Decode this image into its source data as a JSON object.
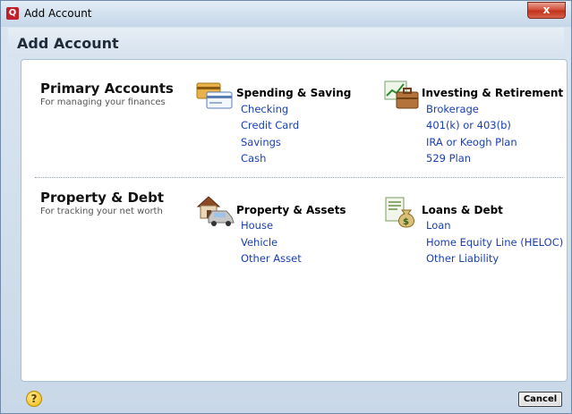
{
  "window": {
    "title": "Add Account",
    "close_label": "x"
  },
  "header": {
    "title": "Add Account"
  },
  "primary": {
    "title": "Primary Accounts",
    "subtitle": "For managing your finances",
    "spending": {
      "title": "Spending & Saving",
      "icon": "credit-card-icon",
      "links": [
        "Checking",
        "Credit Card",
        "Savings",
        "Cash"
      ]
    },
    "investing": {
      "title": "Investing & Retirement",
      "icon": "chart-briefcase-icon",
      "links": [
        "Brokerage",
        "401(k) or 403(b)",
        "IRA or Keogh Plan",
        "529 Plan"
      ]
    }
  },
  "property": {
    "title": "Property & Debt",
    "subtitle": "For tracking your net worth",
    "assets": {
      "title": "Property & Assets",
      "icon": "house-car-icon",
      "links": [
        "House",
        "Vehicle",
        "Other Asset"
      ]
    },
    "loans": {
      "title": "Loans & Debt",
      "icon": "money-bag-icon",
      "links": [
        "Loan",
        "Home Equity Line (HELOC)",
        "Other Liability"
      ]
    }
  },
  "footer": {
    "help_label": "?",
    "cancel_label": "Cancel"
  },
  "colors": {
    "link": "#1a3fb0",
    "accent": "#c0202a"
  }
}
